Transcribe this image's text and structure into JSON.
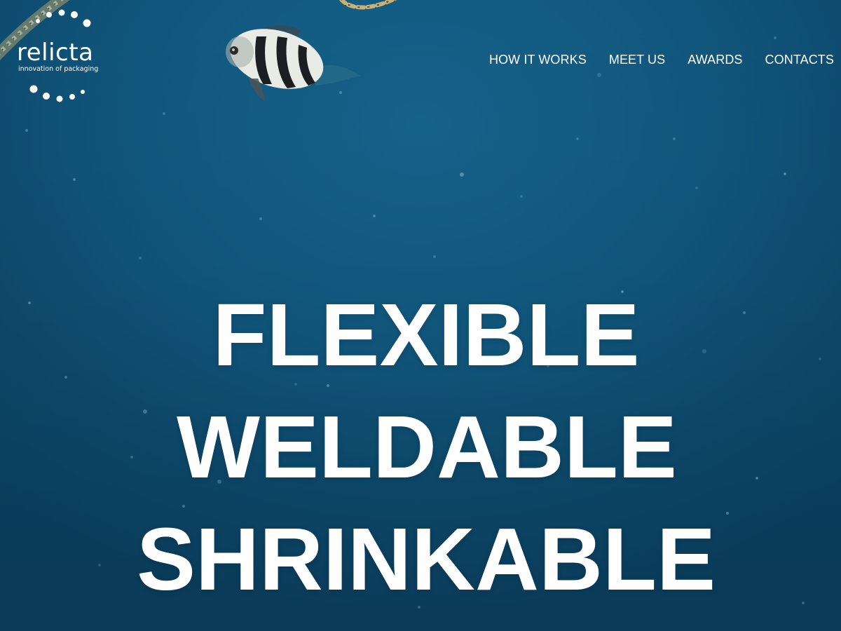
{
  "logo": {
    "name": "relicta",
    "tagline": "innovation of packaging"
  },
  "nav": {
    "items": [
      {
        "label": "HOW IT WORKS"
      },
      {
        "label": "MEET US"
      },
      {
        "label": "AWARDS"
      },
      {
        "label": "CONTACTS"
      }
    ]
  },
  "hero": {
    "lines": [
      "FLEXIBLE",
      "WELDABLE",
      "SHRINKABLE"
    ]
  },
  "colors": {
    "ocean": "#11577d",
    "text": "#ffffff"
  },
  "icons": {
    "logo_mark": "dotted-circle-icon"
  }
}
